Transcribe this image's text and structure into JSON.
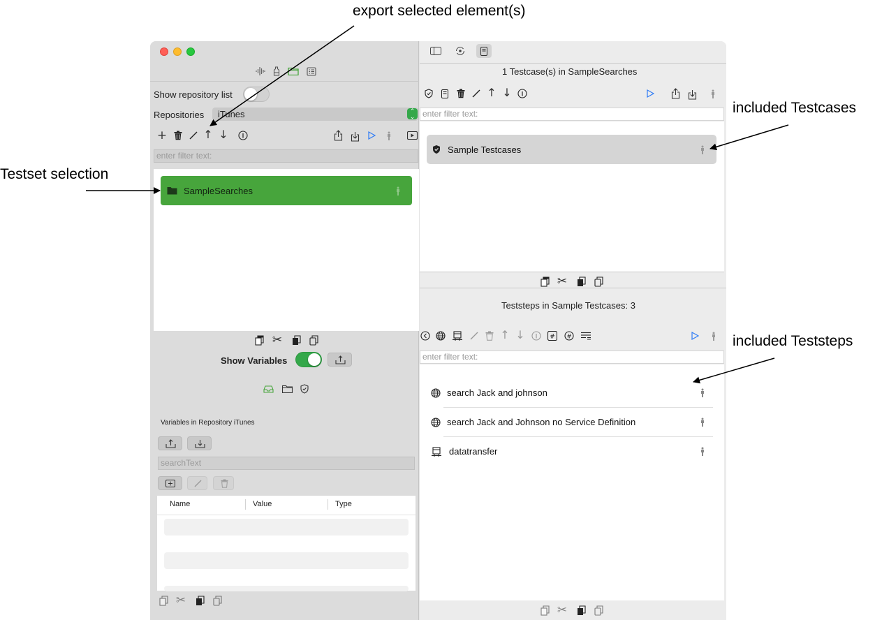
{
  "annotations": {
    "export": "export selected element(s)",
    "testset": "Testset selection",
    "testcases": "included Testcases",
    "teststeps": "included Teststeps"
  },
  "left": {
    "show_repository_list_label": "Show repository list",
    "show_repository_list_on": false,
    "repositories_label": "Repositories",
    "repository_selected": "iTunes",
    "filter_placeholder": "enter filter text:",
    "testsets": [
      {
        "label": "SampleSearches",
        "selected": true
      }
    ],
    "show_variables_label": "Show Variables",
    "show_variables_on": true,
    "variables_title": "Variables in  Repository iTunes",
    "variables_filter_value": "searchText",
    "table_headers": [
      "Name",
      "Value",
      "Type"
    ]
  },
  "right": {
    "testcases_title": "1 Testcase(s) in SampleSearches",
    "filter_placeholder": "enter filter text:",
    "testcases": [
      {
        "label": "Sample Testcases"
      }
    ],
    "teststeps_title": "Teststeps in Sample Testcases: 3",
    "teststeps": [
      {
        "label": "search Jack and johnson",
        "icon": "globe-icon"
      },
      {
        "label": "search Jack and Johnson no Service Definition",
        "icon": "globe-icon"
      },
      {
        "label": "datatransfer",
        "icon": "transfer-icon"
      }
    ]
  },
  "colors": {
    "accent_green": "#47a53c",
    "toggle_on": "#34a84a",
    "play_blue": "#2f7cf6"
  },
  "icons": {
    "left_toolbar": [
      "add-icon",
      "trash-icon",
      "edit-icon",
      "arrow-up-icon",
      "arrow-down-icon",
      "info-icon",
      "export-icon",
      "import-icon",
      "play-icon",
      "figure-icon",
      "media-icon"
    ],
    "clipboard": [
      "copy-icon",
      "cut-icon",
      "paste-icon",
      "duplicate-icon"
    ]
  }
}
